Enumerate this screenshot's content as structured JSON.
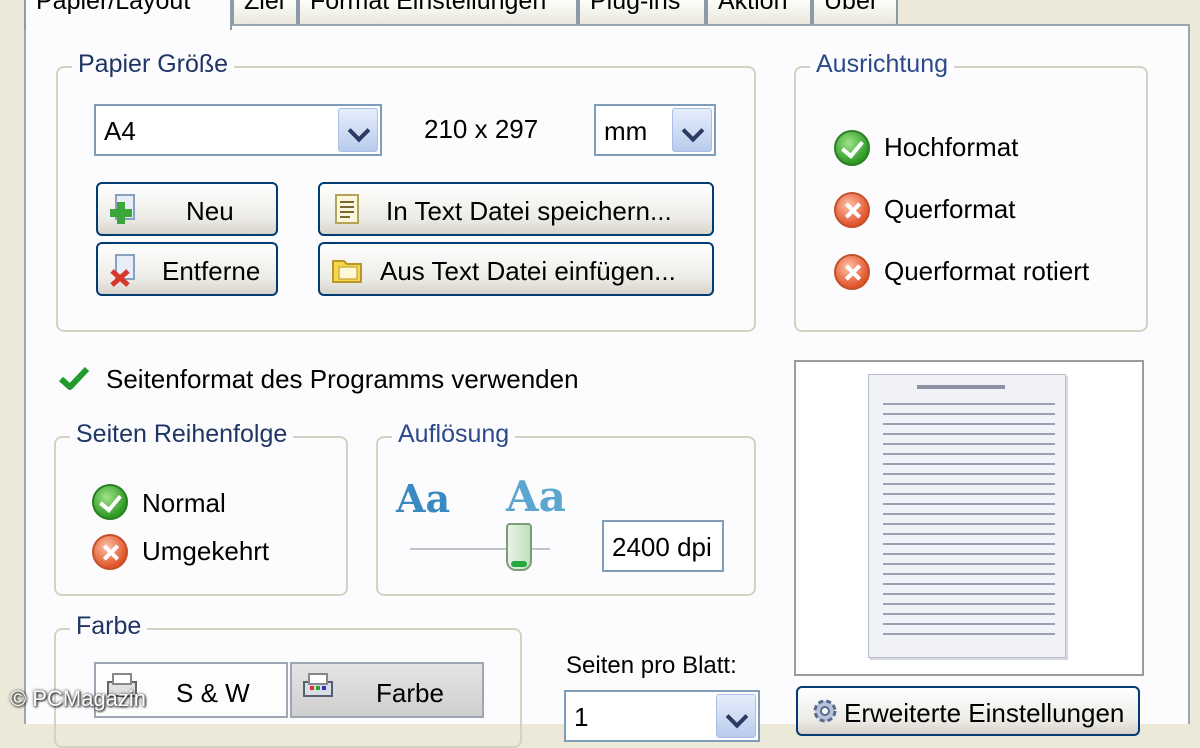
{
  "tabs": [
    {
      "label": "Papier/Layout"
    },
    {
      "label": "Ziel"
    },
    {
      "label": "Format Einstellungen"
    },
    {
      "label": "Plug-ins"
    },
    {
      "label": "Aktion"
    },
    {
      "label": "Über"
    }
  ],
  "paper_size": {
    "title": "Papier Größe",
    "format_value": "A4",
    "dimensions": "210 x 297",
    "unit_value": "mm",
    "new_label": "Neu",
    "remove_label": "Entferne",
    "save_text_label": "In Text Datei speichern...",
    "insert_text_label": "Aus Text Datei einfügen..."
  },
  "orientation": {
    "title": "Ausrichtung",
    "options": [
      {
        "label": "Hochformat",
        "selected": true
      },
      {
        "label": "Querformat",
        "selected": false
      },
      {
        "label": "Querformat rotiert",
        "selected": false
      }
    ]
  },
  "use_program_format": {
    "label": "Seitenformat des Programms verwenden",
    "checked": true
  },
  "page_order": {
    "title": "Seiten Reihenfolge",
    "options": [
      {
        "label": "Normal",
        "selected": true
      },
      {
        "label": "Umgekehrt",
        "selected": false
      }
    ]
  },
  "resolution": {
    "title": "Auflösung",
    "glyph_small": "Aa",
    "glyph_large": "Aa",
    "value": "2400 dpi"
  },
  "color": {
    "title": "Farbe",
    "bw_label": "S & W",
    "color_label": "Farbe",
    "selected": "Farbe"
  },
  "pages_per_sheet": {
    "label": "Seiten pro Blatt:",
    "value": "1"
  },
  "advanced_button": {
    "label": "Erweiterte Einstellungen"
  },
  "watermark": {
    "text": "© PCMagazin"
  },
  "colors": {
    "accent": "#003c74",
    "legend": "#2c4a8a",
    "panel": "#fcfcfe"
  }
}
